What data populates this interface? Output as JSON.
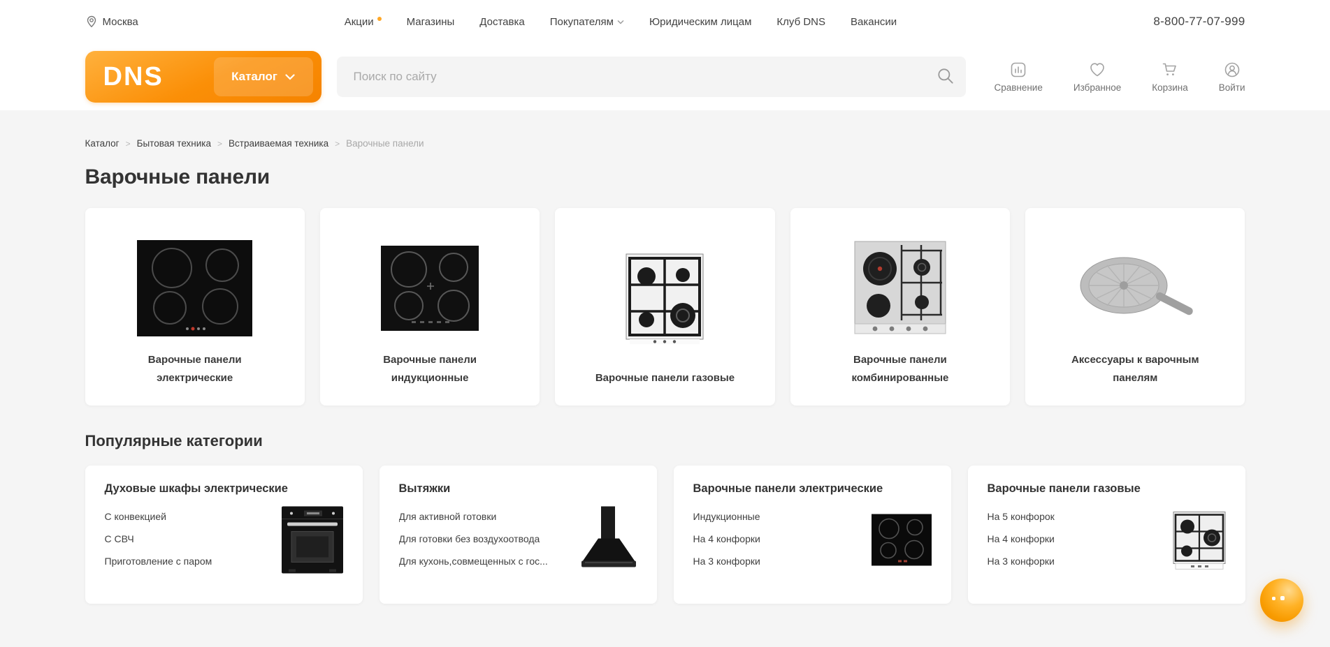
{
  "topbar": {
    "location": "Москва",
    "nav": [
      {
        "label": "Акции"
      },
      {
        "label": "Магазины"
      },
      {
        "label": "Доставка"
      },
      {
        "label": "Покупателям"
      },
      {
        "label": "Юридическим лицам"
      },
      {
        "label": "Клуб DNS"
      },
      {
        "label": "Вакансии"
      }
    ],
    "phone": "8-800-77-07-999"
  },
  "header": {
    "logo_text": "DNS",
    "catalog_label": "Каталог",
    "search_placeholder": "Поиск по сайту",
    "actions": [
      {
        "label": "Сравнение",
        "icon": "compare-icon"
      },
      {
        "label": "Избранное",
        "icon": "heart-icon"
      },
      {
        "label": "Корзина",
        "icon": "cart-icon"
      },
      {
        "label": "Войти",
        "icon": "user-icon"
      }
    ]
  },
  "breadcrumb": {
    "separator": ">",
    "items": [
      {
        "label": "Каталог"
      },
      {
        "label": "Бытовая техника"
      },
      {
        "label": "Встраиваемая техника"
      },
      {
        "label": "Варочные панели"
      }
    ]
  },
  "page_title": "Варочные панели",
  "categories": [
    {
      "label": "Варочные панели электрические",
      "image": "electric-hob"
    },
    {
      "label": "Варочные панели индукционные",
      "image": "induction-hob"
    },
    {
      "label": "Варочные панели газовые",
      "image": "gas-hob"
    },
    {
      "label": "Варочные панели комбинированные",
      "image": "combined-hob"
    },
    {
      "label": "Аксессуары к варочным панелям",
      "image": "hob-adapter"
    }
  ],
  "popular": {
    "heading": "Популярные категории",
    "cards": [
      {
        "title": "Духовые шкафы электрические",
        "links": [
          "С конвекцией",
          "С СВЧ",
          "Приготовление с паром"
        ],
        "image": "electric-oven"
      },
      {
        "title": "Вытяжки",
        "links": [
          "Для активной готовки",
          "Для готовки без воздухоотвода",
          "Для кухонь,совмещенных с гос..."
        ],
        "image": "cooker-hood"
      },
      {
        "title": "Варочные панели электрические",
        "links": [
          "Индукционные",
          "На 4 конфорки",
          "На 3 конфорки"
        ],
        "image": "electric-hob-small"
      },
      {
        "title": "Варочные панели газовые",
        "links": [
          "На 5 конфорок",
          "На 4 конфорки",
          "На 3 конфорки"
        ],
        "image": "gas-hob-small"
      }
    ]
  },
  "colors": {
    "brand_orange": "#fb8f07",
    "accent_dot": "#ffa726",
    "background": "#f5f5f5",
    "card_bg": "#ffffff",
    "text_dark": "#333333",
    "text_muted": "#a8a8a8",
    "icon_gray": "#a3a3a3"
  }
}
